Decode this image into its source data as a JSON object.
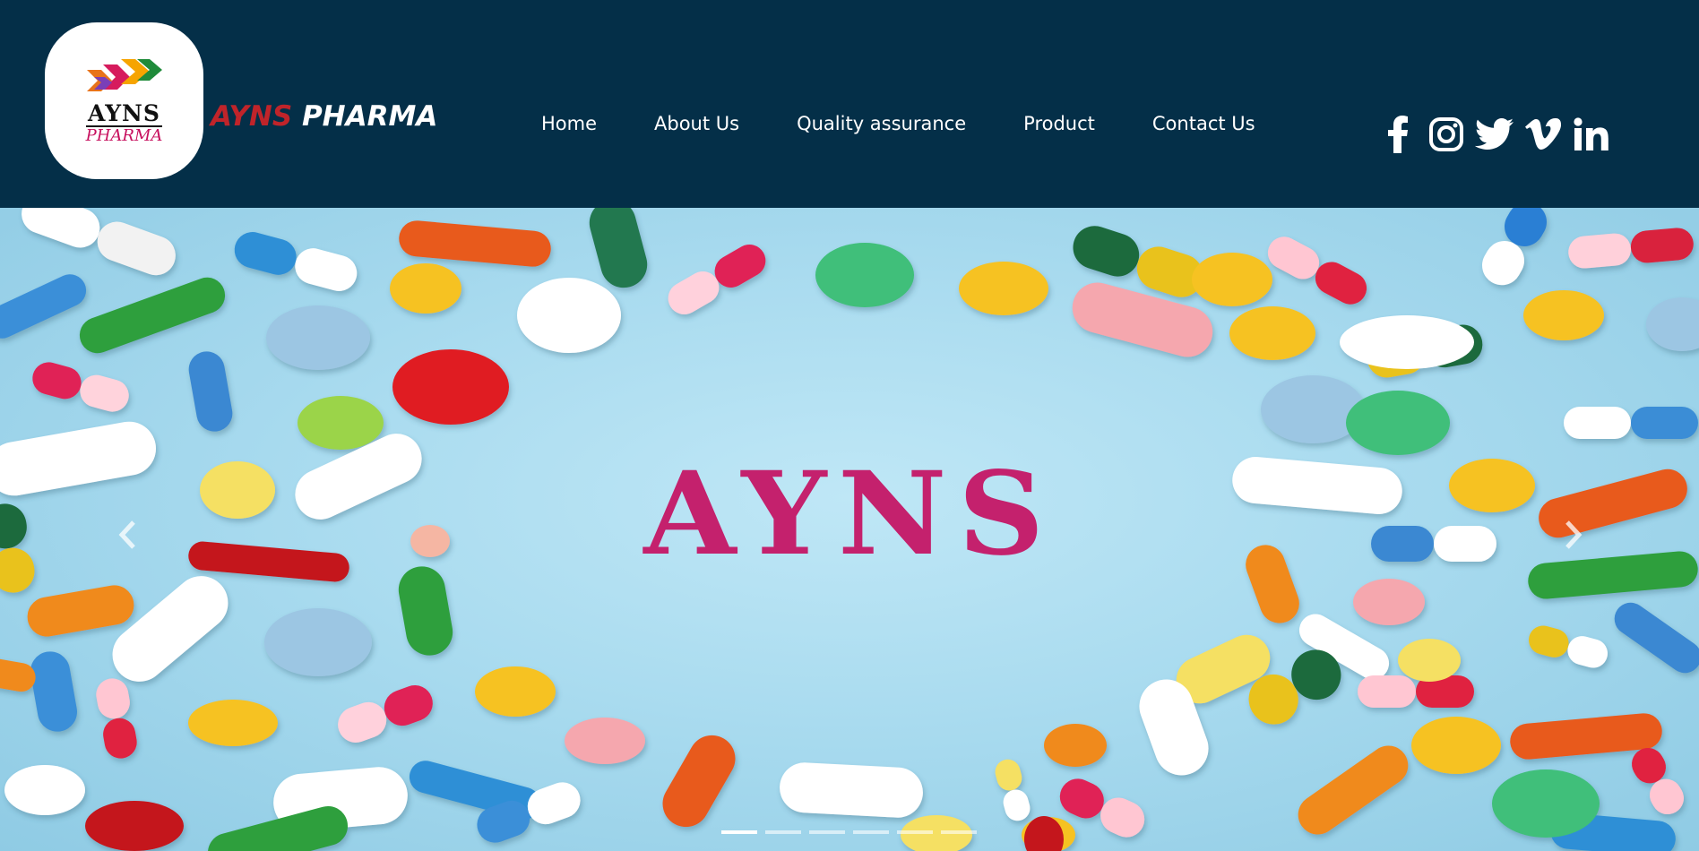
{
  "logo": {
    "word": "AYNS",
    "sub": "PHARMA",
    "colors": [
      "#f6a400",
      "#d61b5d",
      "#1f8b3a",
      "#7a3fb8"
    ]
  },
  "brand": {
    "part1": "AYNS",
    "part2": " PHARMA",
    "color1": "#c0242a",
    "color2": "#ffffff"
  },
  "nav": {
    "items": [
      {
        "label": "Home"
      },
      {
        "label": "About Us"
      },
      {
        "label": "Quality assurance"
      },
      {
        "label": "Product"
      },
      {
        "label": "Contact Us"
      }
    ]
  },
  "social": [
    {
      "icon": "facebook-icon"
    },
    {
      "icon": "instagram-icon"
    },
    {
      "icon": "twitter-icon"
    },
    {
      "icon": "vimeo-icon"
    },
    {
      "icon": "linkedin-icon"
    }
  ],
  "hero": {
    "title": "AYNS",
    "title_color": "#c4216d",
    "slides": 6,
    "active_slide": 1,
    "prev_icon": "chevron-left-icon",
    "next_icon": "chevron-right-icon"
  },
  "colors": {
    "header_bg": "#042f48",
    "hero_bg": "#a9dbef"
  }
}
